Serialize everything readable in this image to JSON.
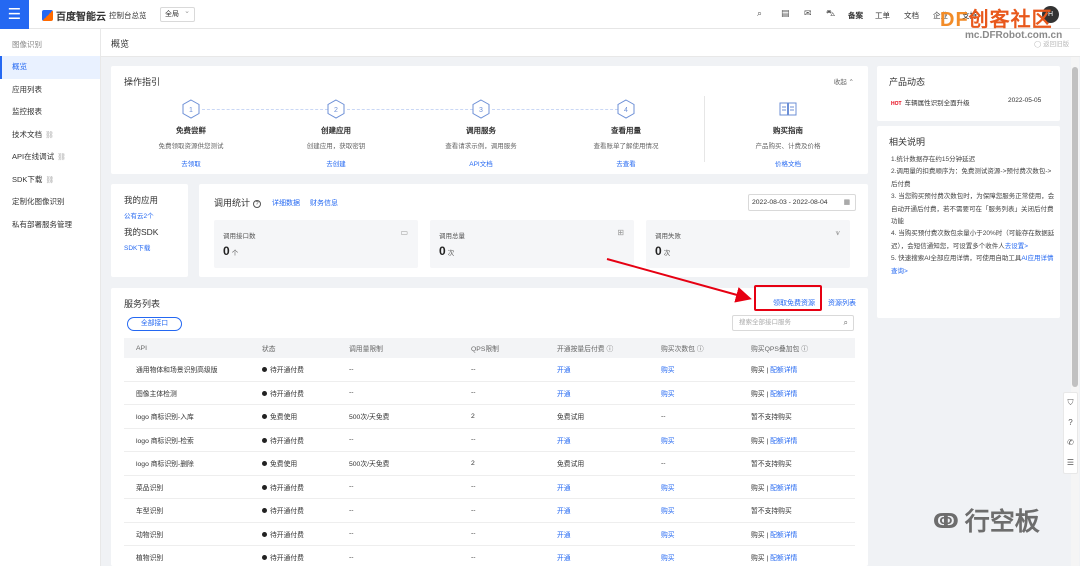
{
  "topbar": {
    "menu_icon": "menu-icon",
    "brand": "百度智能云",
    "console_overview": "控制台总览",
    "region": "全局",
    "items": [
      "备案",
      "工单",
      "文档",
      "企业",
      "支持"
    ],
    "avatar_letter": "H"
  },
  "watermark": {
    "df": "DF",
    "cn": "创客社区",
    "url": "mc.DFRobot.com.cn",
    "bottom": "行空板"
  },
  "sidebar": {
    "title": "图像识别",
    "items": [
      {
        "label": "概览",
        "active": true
      },
      {
        "label": "应用列表"
      },
      {
        "label": "监控报表"
      },
      {
        "label": "技术文档",
        "ext": "🔗"
      },
      {
        "label": "API在线调试",
        "ext": "🔗"
      },
      {
        "label": "SDK下载",
        "ext": "🔗"
      },
      {
        "label": "定制化图像识别"
      },
      {
        "label": "私有部署服务管理"
      }
    ]
  },
  "page": {
    "title": "概览",
    "faint_text": "返回旧版"
  },
  "guide": {
    "title": "操作指引",
    "collapse": "收起 ⌃",
    "steps": [
      {
        "num": "1",
        "title": "免费尝鲜",
        "desc": "免费领取资源供您测试",
        "link": "去领取"
      },
      {
        "num": "2",
        "title": "创建应用",
        "desc": "创建应用，获取密钥",
        "link": "去创建"
      },
      {
        "num": "3",
        "title": "调用服务",
        "desc": "查看请求示例，调用服务",
        "link": "API文档"
      },
      {
        "num": "4",
        "title": "查看用量",
        "desc": "查看账单了解使用情况",
        "link": "去查看"
      }
    ],
    "purchase": {
      "title": "购买指南",
      "desc": "产品购买、计费及价格",
      "link": "价格文档"
    }
  },
  "myapp": {
    "title": "我的应用",
    "count": "公有云2个",
    "sdk_title": "我的SDK",
    "sdk_link": "SDK下载"
  },
  "stats": {
    "title": "调用统计",
    "detail": "详细数据",
    "finance": "财务信息",
    "date_range": "2022-08-03 - 2022-08-04",
    "boxes": [
      {
        "label": "调用接口数",
        "value": "0",
        "unit": "个"
      },
      {
        "label": "调用总量",
        "value": "0",
        "unit": "次"
      },
      {
        "label": "调用失败",
        "value": "0",
        "unit": "次"
      }
    ]
  },
  "services": {
    "title": "服务列表",
    "free_link": "领取免费资源",
    "list_link": "资源列表",
    "all_button": "全部接口",
    "search_placeholder": "搜索全部接口服务",
    "headers": [
      "API",
      "状态",
      "调用量限制",
      "QPS限制",
      "开通按量后付费 ⓘ",
      "购买次数包 ⓘ",
      "购买QPS叠加包 ⓘ"
    ],
    "rows": [
      [
        "通用物体和场景识别高级版",
        "待开通付费",
        "--",
        "--",
        "开通",
        "购买",
        "购买 | 配额详情"
      ],
      [
        "图像主体检测",
        "待开通付费",
        "--",
        "--",
        "开通",
        "购买",
        "购买 | 配额详情"
      ],
      [
        "logo 商标识别-入库",
        "免费使用",
        "500次/天免费",
        "2",
        "免费试用",
        "--",
        "暂不支持购买"
      ],
      [
        "logo 商标识别-检索",
        "待开通付费",
        "--",
        "--",
        "开通",
        "购买",
        "购买 | 配额详情"
      ],
      [
        "logo 商标识别-删除",
        "免费使用",
        "500次/天免费",
        "2",
        "免费试用",
        "--",
        "暂不支持购买"
      ],
      [
        "菜品识别",
        "待开通付费",
        "--",
        "--",
        "开通",
        "购买",
        "购买 | 配额详情"
      ],
      [
        "车型识别",
        "待开通付费",
        "--",
        "--",
        "开通",
        "购买",
        "暂不支持购买"
      ],
      [
        "动物识别",
        "待开通付费",
        "--",
        "--",
        "开通",
        "购买",
        "购买 | 配额详情"
      ],
      [
        "植物识别",
        "待开通付费",
        "--",
        "--",
        "开通",
        "购买",
        "购买 | 配额详情"
      ]
    ]
  },
  "news": {
    "title": "产品动态",
    "tag": "HOT",
    "text": "车辆属性识别全面升级",
    "date": "2022-05-05"
  },
  "notes": {
    "title": "相关说明",
    "items": [
      "1.统计数据存在约15分钟延迟",
      "2.调用量的扣费顺序为：免费测试资源->预付费次数包->后付费",
      "3. 当您购买预付费次数包时，为保障您服务正常使用，会自动开通后付费，若不需要可在「服务列表」关闭后付费功能",
      "4. 当购买预付费次数包余量小于20%时（可能存在数据延迟），会短信通知您，可设置多个收件人",
      "5. 快速搜索AI全部应用详情，可使用自助工具"
    ],
    "link4": "去设置>",
    "link5a": "AI应用",
    "link5b": "详情查询>"
  },
  "colors": {
    "accent": "#2468f2",
    "highlight": "#e60012"
  }
}
